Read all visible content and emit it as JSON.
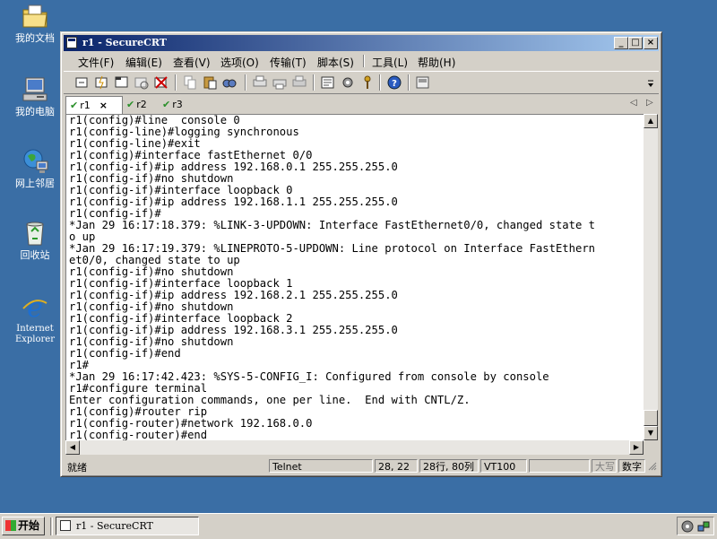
{
  "desktop": {
    "icons": [
      {
        "label": "我的文档",
        "icon": "my-documents-icon"
      },
      {
        "label": "我的电脑",
        "icon": "my-computer-icon"
      },
      {
        "label": "网上邻居",
        "icon": "network-places-icon"
      },
      {
        "label": "回收站",
        "icon": "recycle-bin-icon"
      },
      {
        "label": "Internet Explorer",
        "icon": "internet-explorer-icon"
      }
    ]
  },
  "window": {
    "title": "r1 - SecureCRT",
    "menu": [
      "文件(F)",
      "编辑(E)",
      "查看(V)",
      "选项(O)",
      "传输(T)",
      "脚本(S)",
      "工具(L)",
      "帮助(H)"
    ],
    "tabs": [
      {
        "label": "r1",
        "active": true,
        "close": "×"
      },
      {
        "label": "r2",
        "active": false
      },
      {
        "label": "r3",
        "active": false
      }
    ],
    "terminal_lines": [
      "r1(config)#line  console 0",
      "r1(config-line)#logging synchronous",
      "r1(config-line)#exit",
      "r1(config)#interface fastEthernet 0/0",
      "r1(config-if)#ip address 192.168.0.1 255.255.255.0",
      "r1(config-if)#no shutdown",
      "r1(config-if)#interface loopback 0",
      "r1(config-if)#ip address 192.168.1.1 255.255.255.0",
      "r1(config-if)#",
      "*Jan 29 16:17:18.379: %LINK-3-UPDOWN: Interface FastEthernet0/0, changed state t",
      "o up",
      "*Jan 29 16:17:19.379: %LINEPROTO-5-UPDOWN: Line protocol on Interface FastEthern",
      "et0/0, changed state to up",
      "r1(config-if)#no shutdown",
      "r1(config-if)#interface loopback 1",
      "r1(config-if)#ip address 192.168.2.1 255.255.255.0",
      "r1(config-if)#no shutdown",
      "r1(config-if)#interface loopback 2",
      "r1(config-if)#ip address 192.168.3.1 255.255.255.0",
      "r1(config-if)#no shutdown",
      "r1(config-if)#end",
      "r1#",
      "*Jan 29 16:17:42.423: %SYS-5-CONFIG_I: Configured from console by console",
      "r1#configure terminal",
      "Enter configuration commands, one per line.  End with CNTL/Z.",
      "r1(config)#router rip",
      "r1(config-router)#network 192.168.0.0",
      "r1(config-router)#end"
    ],
    "status": {
      "ready": "就绪",
      "protocol": "Telnet",
      "cursor": "28, 22",
      "size": "28行, 80列",
      "terminal_type": "VT100",
      "caps": "大写",
      "num": "数字"
    }
  },
  "taskbar": {
    "start_label": "开始",
    "task_label": "r1 - SecureCRT"
  }
}
